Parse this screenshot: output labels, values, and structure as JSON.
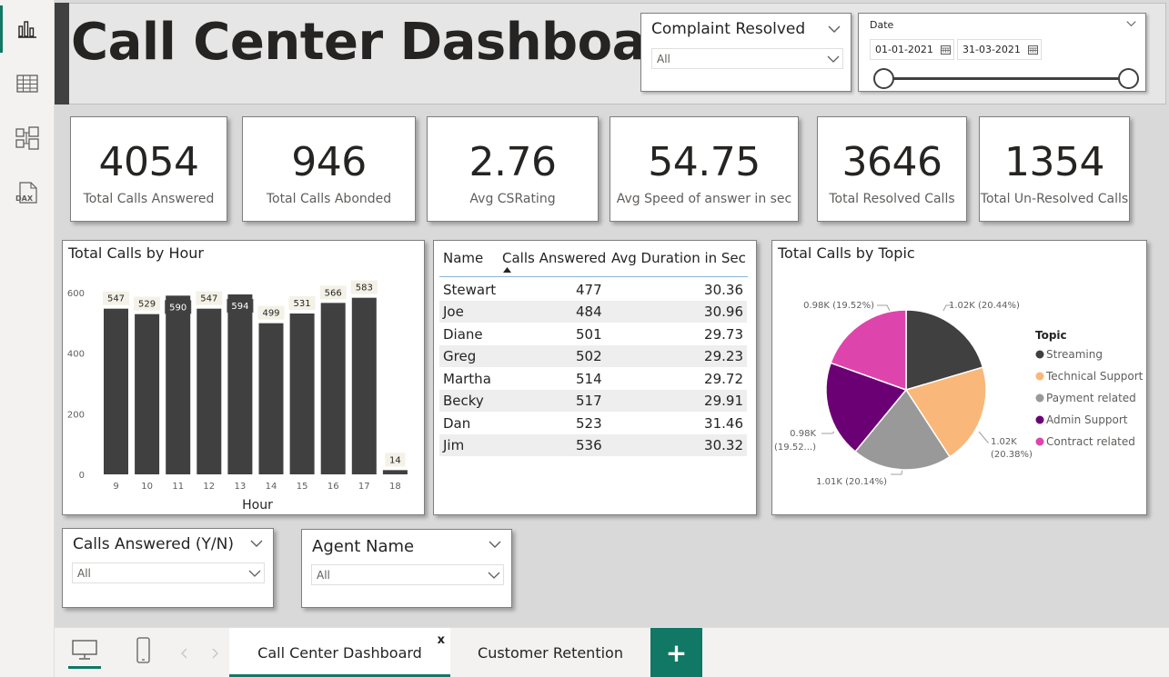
{
  "rail": {
    "items": [
      {
        "icon": "report-view-icon"
      },
      {
        "icon": "data-view-icon"
      },
      {
        "icon": "model-view-icon"
      },
      {
        "icon": "dax-query-icon",
        "label": "DAX"
      }
    ]
  },
  "header": {
    "title": "Call Center Dashboard",
    "complaint_slicer": {
      "title": "Complaint Resolved",
      "value": "All"
    },
    "date_slicer": {
      "title": "Date",
      "start": "01-01-2021",
      "end": "31-03-2021"
    }
  },
  "kpis": [
    {
      "value": "4054",
      "label": "Total Calls Answered"
    },
    {
      "value": "946",
      "label": "Total Calls Abonded"
    },
    {
      "value": "2.76",
      "label": "Avg CSRating"
    },
    {
      "value": "54.75",
      "label": "Avg Speed of answer in sec"
    },
    {
      "value": "3646",
      "label": "Total Resolved Calls"
    },
    {
      "value": "1354",
      "label": "Total Un-Resolved Calls"
    }
  ],
  "hour_chart": {
    "title": "Total Calls by Hour",
    "chart_data": {
      "type": "bar",
      "title": "Total Calls by Hour",
      "xlabel": "Hour",
      "ylabel": "",
      "categories": [
        "9",
        "10",
        "11",
        "12",
        "13",
        "14",
        "15",
        "16",
        "17",
        "18"
      ],
      "values": [
        547,
        529,
        590,
        547,
        594,
        499,
        531,
        566,
        583,
        14
      ],
      "ylim": [
        0,
        600
      ],
      "yticks": [
        0,
        200,
        400,
        600
      ],
      "grid": false,
      "bar_color": "#404040"
    }
  },
  "agent_table": {
    "headers": [
      "Name",
      "Calls Answered",
      "Avg Duration in Sec"
    ],
    "rows": [
      [
        "Stewart",
        "477",
        "30.36"
      ],
      [
        "Joe",
        "484",
        "30.96"
      ],
      [
        "Diane",
        "501",
        "29.73"
      ],
      [
        "Greg",
        "502",
        "29.23"
      ],
      [
        "Martha",
        "514",
        "29.72"
      ],
      [
        "Becky",
        "517",
        "29.91"
      ],
      [
        "Dan",
        "523",
        "31.46"
      ],
      [
        "Jim",
        "536",
        "30.32"
      ]
    ]
  },
  "topic_chart": {
    "title": "Total Calls by Topic",
    "legend_title": "Topic",
    "chart_data": {
      "type": "pie",
      "title": "Total Calls by Topic",
      "legend_title": "Topic",
      "legend_position": "right",
      "slices": [
        {
          "name": "Streaming",
          "value": 1.02,
          "percent": 20.44,
          "label": "1.02K (20.44%)",
          "color": "#404040"
        },
        {
          "name": "Technical Support",
          "value": 1.02,
          "percent": 20.38,
          "label_line1": "1.02K",
          "label_line2": "(20.38%)",
          "color": "#f9b77a"
        },
        {
          "name": "Payment related",
          "value": 1.01,
          "percent": 20.14,
          "label": "1.01K (20.14%)",
          "color": "#999999"
        },
        {
          "name": "Admin Support",
          "value": 0.98,
          "percent": 19.52,
          "label_line1": "0.98K",
          "label_line2": "(19.52...)",
          "color": "#6b0074"
        },
        {
          "name": "Contract related",
          "value": 0.98,
          "percent": 19.52,
          "label": "0.98K (19.52%)",
          "color": "#de45ac"
        }
      ]
    }
  },
  "slicers": {
    "calls_answered": {
      "title": "Calls Answered (Y/N)",
      "value": "All"
    },
    "agent_name": {
      "title": "Agent Name",
      "value": "All"
    }
  },
  "tabs": {
    "pages": [
      {
        "label": "Call Center Dashboard",
        "close": "x"
      },
      {
        "label": "Customer Retention"
      }
    ],
    "add_label": "+"
  },
  "colors": {
    "accent": "#117865",
    "bar": "#404040"
  }
}
